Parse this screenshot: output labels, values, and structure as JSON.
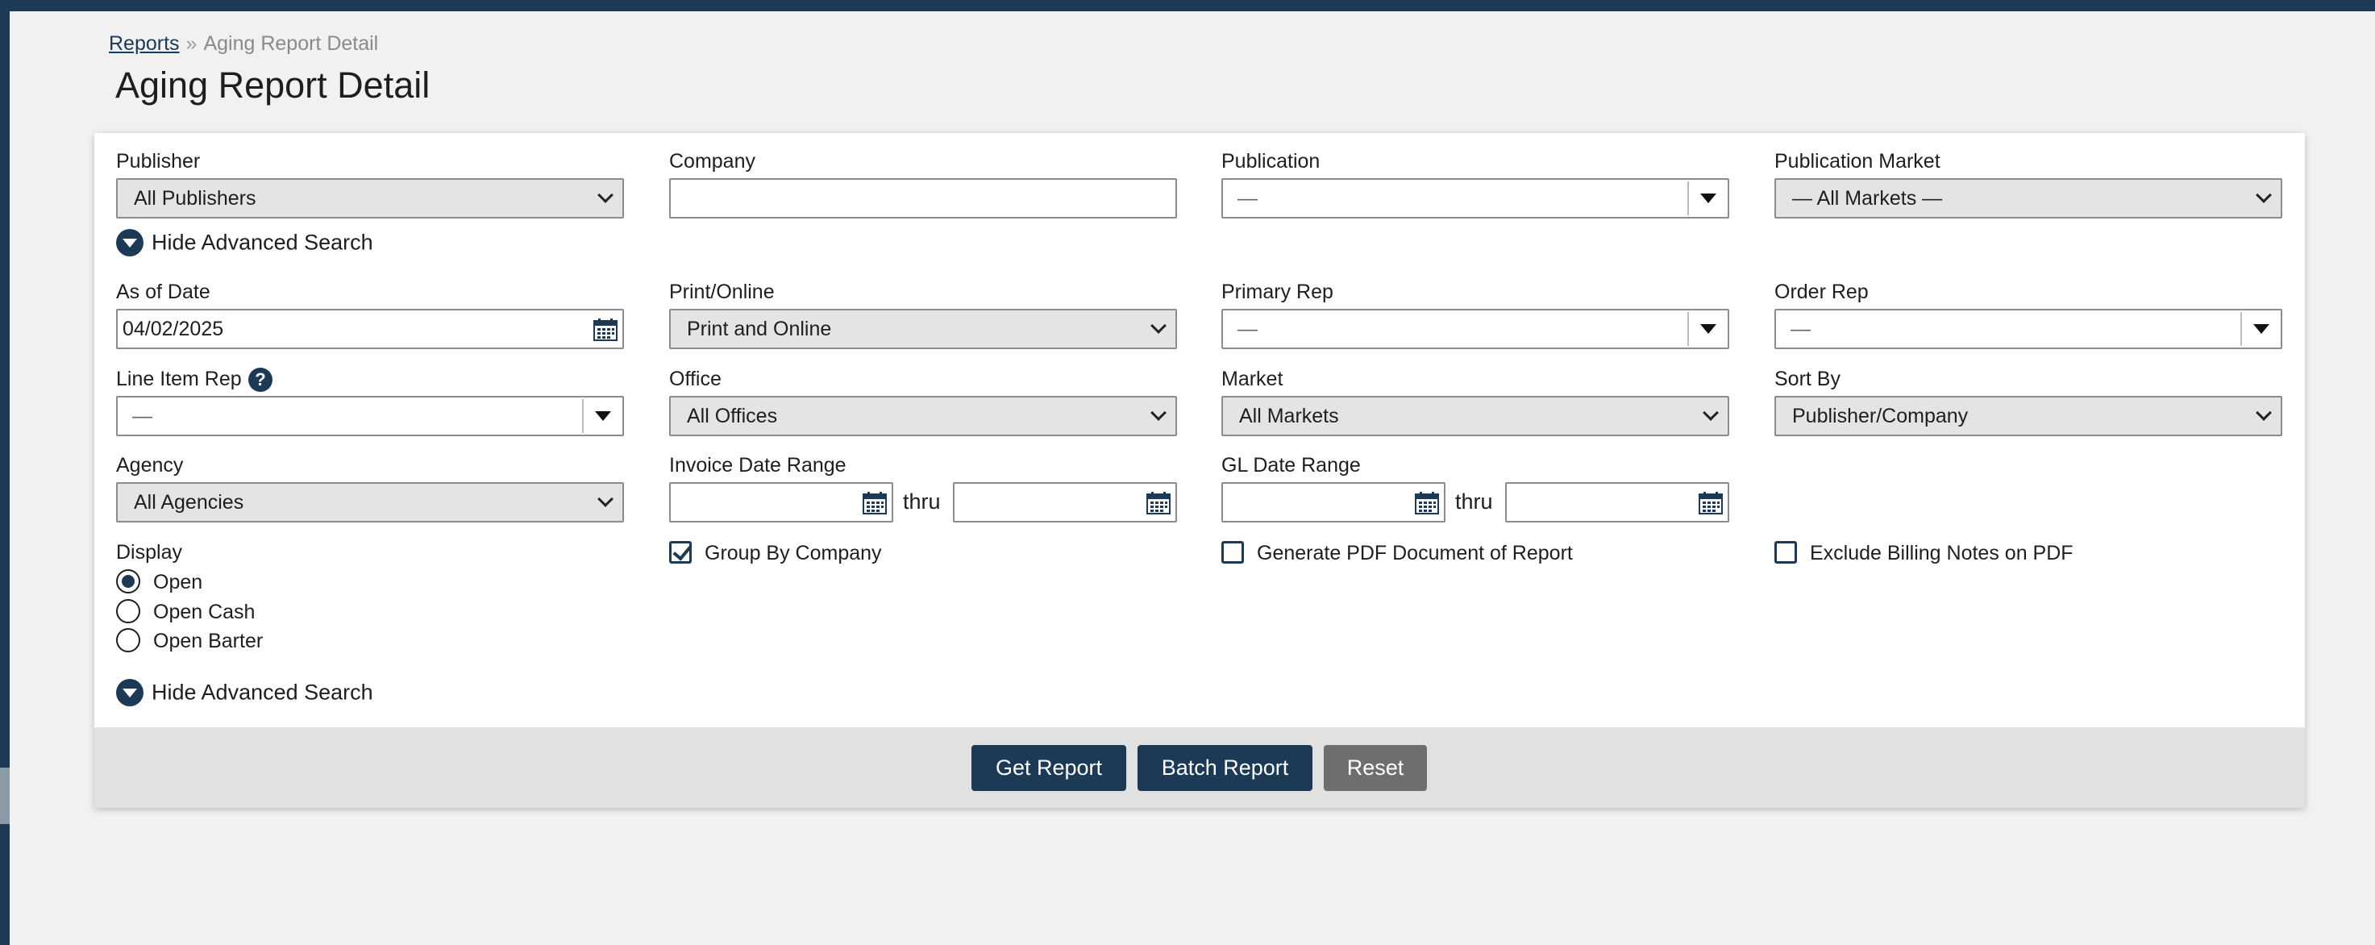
{
  "breadcrumb": {
    "link": "Reports",
    "separator": "»",
    "current": "Aging Report Detail"
  },
  "page_title": "Aging Report Detail",
  "form": {
    "publisher": {
      "label": "Publisher",
      "value": "All Publishers"
    },
    "company": {
      "label": "Company",
      "value": ""
    },
    "publication": {
      "label": "Publication",
      "value": "—"
    },
    "publication_market": {
      "label": "Publication Market",
      "value": "— All Markets —"
    },
    "advanced_toggle": "Hide Advanced Search",
    "as_of_date": {
      "label": "As of Date",
      "value": "04/02/2025"
    },
    "print_online": {
      "label": "Print/Online",
      "value": "Print and Online"
    },
    "primary_rep": {
      "label": "Primary Rep",
      "value": "—"
    },
    "order_rep": {
      "label": "Order Rep",
      "value": "—"
    },
    "line_item_rep": {
      "label": "Line Item Rep",
      "value": "—",
      "help": "?"
    },
    "office": {
      "label": "Office",
      "value": "All Offices"
    },
    "market": {
      "label": "Market",
      "value": "All Markets"
    },
    "sort_by": {
      "label": "Sort By",
      "value": "Publisher/Company"
    },
    "agency": {
      "label": "Agency",
      "value": "All Agencies"
    },
    "invoice_date_range": {
      "label": "Invoice Date Range",
      "from": "",
      "to": "",
      "thru": "thru"
    },
    "gl_date_range": {
      "label": "GL Date Range",
      "from": "",
      "to": "",
      "thru": "thru"
    },
    "display": {
      "label": "Display",
      "options": [
        "Open",
        "Open Cash",
        "Open Barter"
      ],
      "selected": "Open"
    },
    "group_by_company": {
      "label": "Group By Company",
      "checked": true
    },
    "generate_pdf": {
      "label": "Generate PDF Document of Report",
      "checked": false
    },
    "exclude_billing_notes": {
      "label": "Exclude Billing Notes on PDF",
      "checked": false
    }
  },
  "buttons": {
    "get_report": "Get Report",
    "batch_report": "Batch Report",
    "reset": "Reset"
  },
  "icons": {
    "calendar": "calendar-icon",
    "chevron": "chevron-down-icon",
    "dropdown": "caret-down-icon",
    "help": "help-icon"
  },
  "colors": {
    "brand": "#1c3a55",
    "reset": "#6e6e6e",
    "select_bg": "#e4e4e4",
    "footer_bg": "#e1e1e1",
    "page_bg": "#f1f1f1"
  }
}
